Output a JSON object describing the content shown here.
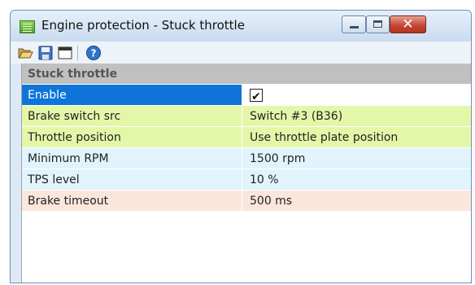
{
  "window": {
    "title": "Engine protection - Stuck throttle",
    "controls": {
      "minimize": "minimize-icon",
      "maximize": "maximize-icon",
      "close": "close-icon"
    }
  },
  "toolbar": {
    "icons": [
      "folder-open-icon",
      "save-icon",
      "window-icon",
      "help-icon"
    ]
  },
  "grid": {
    "header": "Stuck throttle",
    "rows": [
      {
        "name": "Enable",
        "value": "",
        "checked": true,
        "color": "#0f74d9"
      },
      {
        "name": "Brake switch src",
        "value": "Switch #3 (B36)",
        "color": "#e4f7a9"
      },
      {
        "name": "Throttle position",
        "value": "Use throttle plate position",
        "color": "#e4f7a9"
      },
      {
        "name": "Minimum RPM",
        "value": "1500 rpm",
        "color": "#e1f4fb"
      },
      {
        "name": "TPS level",
        "value": "10 %",
        "color": "#e1f4fb"
      },
      {
        "name": "Brake timeout",
        "value": "500 ms",
        "color": "#fbe6dc"
      }
    ]
  },
  "colors": {
    "selection": "#0f74d9",
    "header_bg": "#c0c0c0",
    "titlebar": "#c9dbef"
  }
}
